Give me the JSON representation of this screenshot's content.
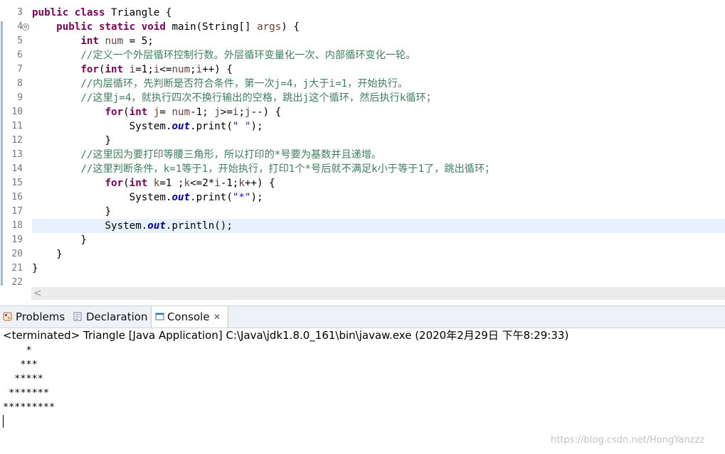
{
  "editor": {
    "line_numbers": [
      "3",
      "4",
      "5",
      "6",
      "7",
      "8",
      "9",
      "10",
      "11",
      "12",
      "13",
      "14",
      "15",
      "16",
      "17",
      "18",
      "19",
      "20",
      "21",
      "22"
    ],
    "fold_glyph": "⊖",
    "lines": [
      [
        {
          "c": "kw",
          "t": "public"
        },
        {
          "t": " "
        },
        {
          "c": "kw",
          "t": "class"
        },
        {
          "t": " Triangle {"
        }
      ],
      [
        {
          "t": "    "
        },
        {
          "c": "kw",
          "t": "public"
        },
        {
          "t": " "
        },
        {
          "c": "kw",
          "t": "static"
        },
        {
          "t": " "
        },
        {
          "c": "kw",
          "t": "void"
        },
        {
          "t": " main(String[] "
        },
        {
          "c": "var",
          "t": "args"
        },
        {
          "t": ") {"
        }
      ],
      [
        {
          "t": "        "
        },
        {
          "c": "kw",
          "t": "int"
        },
        {
          "t": " "
        },
        {
          "c": "var",
          "t": "num"
        },
        {
          "t": " = 5;"
        }
      ],
      [
        {
          "t": "        "
        },
        {
          "c": "cm",
          "t": "//定义一个外层循环控制行数。外层循环变量化一次、内部循环变化一轮。"
        }
      ],
      [
        {
          "t": "        "
        },
        {
          "c": "kw",
          "t": "for"
        },
        {
          "t": "("
        },
        {
          "c": "kw",
          "t": "int"
        },
        {
          "t": " "
        },
        {
          "c": "var",
          "t": "i"
        },
        {
          "t": "=1;"
        },
        {
          "c": "var",
          "t": "i"
        },
        {
          "t": "<="
        },
        {
          "c": "var",
          "t": "num"
        },
        {
          "t": ";"
        },
        {
          "c": "var",
          "t": "i"
        },
        {
          "t": "++) {"
        }
      ],
      [
        {
          "t": "        "
        },
        {
          "c": "cm",
          "t": "//内层循环，先判断是否符合条件，第一次j=4，j大于i=1，开始执行。"
        }
      ],
      [
        {
          "t": "        "
        },
        {
          "c": "cm",
          "t": "//这里j=4，就执行四次不换行输出的空格，跳出j这个循环，然后执行k循环；"
        }
      ],
      [
        {
          "t": "            "
        },
        {
          "c": "kw",
          "t": "for"
        },
        {
          "t": "("
        },
        {
          "c": "kw",
          "t": "int"
        },
        {
          "t": " "
        },
        {
          "c": "var",
          "t": "j"
        },
        {
          "t": "= "
        },
        {
          "c": "var",
          "t": "num"
        },
        {
          "t": "-1; "
        },
        {
          "c": "var",
          "t": "j"
        },
        {
          "t": ">="
        },
        {
          "c": "var",
          "t": "i"
        },
        {
          "t": ";"
        },
        {
          "c": "var",
          "t": "j"
        },
        {
          "t": "--) {"
        }
      ],
      [
        {
          "t": "                System."
        },
        {
          "c": "fld",
          "t": "out"
        },
        {
          "t": ".print("
        },
        {
          "c": "str",
          "t": "\" \""
        },
        {
          "t": ");"
        }
      ],
      [
        {
          "t": "            }"
        }
      ],
      [
        {
          "t": "        "
        },
        {
          "c": "cm",
          "t": "//这里因为要打印等腰三角形，所以打印的*号要为基数并且递增。"
        }
      ],
      [
        {
          "t": "        "
        },
        {
          "c": "cm",
          "t": "//这里判断条件，k=1等于1，开始执行，打印1个*号后就不满足k小于等于1了，跳出循环；"
        }
      ],
      [
        {
          "t": "            "
        },
        {
          "c": "kw",
          "t": "for"
        },
        {
          "t": "("
        },
        {
          "c": "kw",
          "t": "int"
        },
        {
          "t": " "
        },
        {
          "c": "var",
          "t": "k"
        },
        {
          "t": "=1 ;"
        },
        {
          "c": "var",
          "t": "k"
        },
        {
          "t": "<=2*"
        },
        {
          "c": "var",
          "t": "i"
        },
        {
          "t": "-1;"
        },
        {
          "c": "var",
          "t": "k"
        },
        {
          "t": "++) {"
        }
      ],
      [
        {
          "t": "                System."
        },
        {
          "c": "fld",
          "t": "out"
        },
        {
          "t": ".print("
        },
        {
          "c": "str",
          "t": "\"*\""
        },
        {
          "t": ");"
        }
      ],
      [
        {
          "t": "            }"
        }
      ],
      [
        {
          "t": "            System."
        },
        {
          "c": "fld",
          "t": "out"
        },
        {
          "t": ".println();"
        }
      ],
      [
        {
          "t": "        }"
        }
      ],
      [
        {
          "t": "    }"
        }
      ],
      [
        {
          "t": "}"
        }
      ],
      [
        {
          "t": ""
        }
      ]
    ],
    "scroll_arrow": "<"
  },
  "tabs": [
    {
      "label": "Problems",
      "icon": "problems-icon",
      "active": false
    },
    {
      "label": "Declaration",
      "icon": "declaration-icon",
      "active": false
    },
    {
      "label": "Console",
      "icon": "console-icon",
      "active": true,
      "close": "✕"
    }
  ],
  "console": {
    "header": "<terminated> Triangle [Java Application] C:\\Java\\jdk1.8.0_161\\bin\\javaw.exe (2020年2月29日 下午8:29:33)",
    "output": [
      "    *",
      "   ***",
      "  *****",
      " *******",
      "*********"
    ]
  },
  "watermark": "https://blog.csdn.net/HongYanzzz",
  "colors": {
    "keyword": "#7f0055",
    "comment": "#3f7f5f",
    "string": "#2a00ff",
    "field": "#0000c0",
    "current_line": "#e8f2fe"
  }
}
